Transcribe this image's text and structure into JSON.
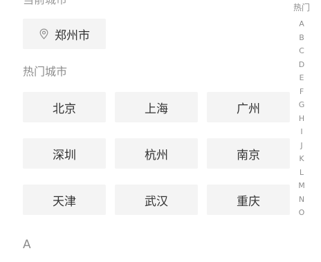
{
  "current": {
    "label": "当前城市",
    "city": "郑州市",
    "icon": "location-pin-icon"
  },
  "hot": {
    "label": "热门城市",
    "cities": [
      "北京",
      "上海",
      "广州",
      "深圳",
      "杭州",
      "南京",
      "天津",
      "武汉",
      "重庆"
    ]
  },
  "section": {
    "first_letter": "A"
  },
  "index": {
    "items": [
      "热门",
      "A",
      "B",
      "C",
      "D",
      "E",
      "F",
      "G",
      "H",
      "I",
      "J",
      "K",
      "L",
      "M",
      "N",
      "O"
    ]
  }
}
